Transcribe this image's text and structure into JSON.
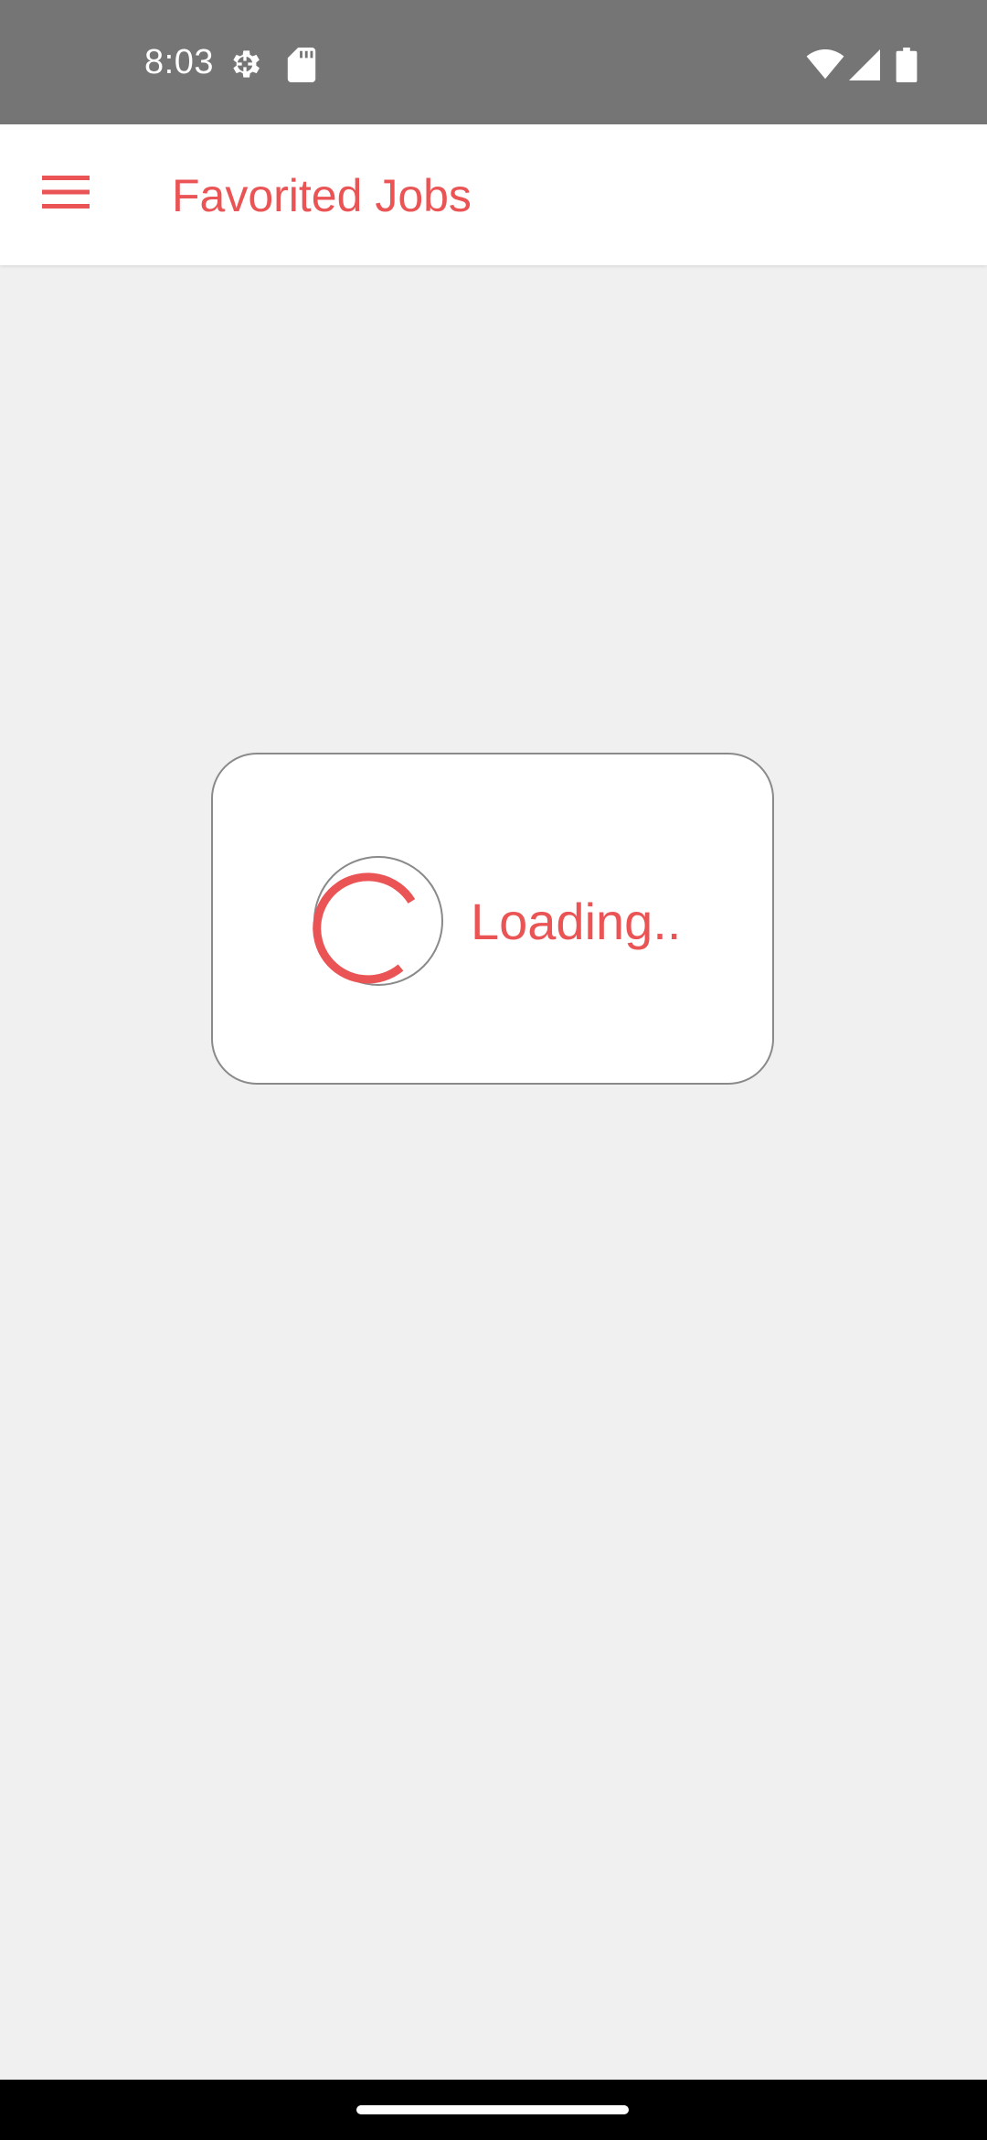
{
  "status_bar": {
    "time": "8:03",
    "icons": [
      "settings-icon",
      "sd-card-icon",
      "wifi-icon",
      "cell-signal-icon",
      "battery-icon"
    ]
  },
  "app_bar": {
    "title": "Favorited Jobs",
    "menu_icon": "menu-icon"
  },
  "loading_dialog": {
    "text": "Loading.."
  },
  "colors": {
    "accent": "#ea5455",
    "status_bar_bg": "#757575",
    "background": "#f0f0f0",
    "nav_bar_bg": "#000000"
  }
}
